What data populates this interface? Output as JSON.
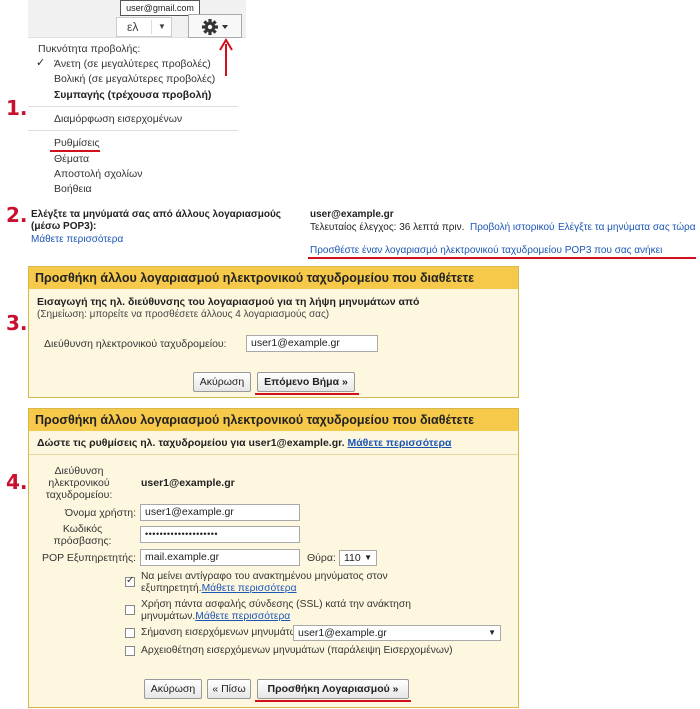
{
  "tooltip": {
    "email": "user@gmail.com"
  },
  "toolbar": {
    "lang_label": "ελ",
    "lang_caret": "▼"
  },
  "menu": {
    "density_header": "Πυκνότητα προβολής:",
    "items": [
      {
        "label": "Άνετη (σε μεγαλύτερες προβολές)",
        "checked": true
      },
      {
        "label": "Βολική (σε μεγαλύτερες προβολές)",
        "checked": false
      },
      {
        "label": "Συμπαγής (τρέχουσα προβολή)",
        "checked": false
      }
    ],
    "inbox_config": "Διαμόρφωση εισερχομένων",
    "settings": "Ρυθμίσεις",
    "themes": "Θέματα",
    "feedback": "Αποστολή σχολίων",
    "help": "Βοήθεια",
    "check_mark": "✓"
  },
  "steps": [
    "1.",
    "2.",
    "3.",
    "4."
  ],
  "step2": {
    "title_line1": "Ελέγξτε τα μηνύματά σας από άλλους λογαριασμούς",
    "title_line2": "(μέσω POP3):",
    "learn_more": "Μάθετε περισσότερα",
    "account": "user@example.gr",
    "last_check": "Τελευταίος έλεγχος: 36 λεπτά πριν.",
    "view_history": "Προβολή ιστορικού",
    "check_now": "Ελέγξτε τα μηνύματα σας τώρα",
    "add_account": "Προσθέστε έναν λογαριασμό ηλεκτρονικού ταχυδρομείου POP3 που σας ανήκει"
  },
  "step3": {
    "title": "Προσθήκη άλλου λογαριασμού ηλεκτρονικού ταχυδρομείου που διαθέτετε",
    "heading": "Εισαγωγή της ηλ. διεύθυνσης του λογαριασμού για τη λήψη μηνυμάτων από",
    "note": "(Σημείωση: μπορείτε να προσθέσετε άλλους 4 λογαριασμούς σας)",
    "email_label": "Διεύθυνση ηλεκτρονικού ταχυδρομείου:",
    "email_value": "user1@example.gr",
    "cancel": "Ακύρωση",
    "next": "Επόμενο Βήμα »"
  },
  "step4": {
    "title": "Προσθήκη άλλου λογαριασμού ηλεκτρονικού ταχυδρομείου που διαθέτετε",
    "heading_prefix": "Δώστε τις ρυθμίσεις ηλ. ταχυδρομείου για user1@example.gr.",
    "learn_more": "Μάθετε περισσότερα",
    "address_label_1": "Διεύθυνση",
    "address_label_2": "ηλεκτρονικού",
    "address_label_3": "ταχυδρομείου:",
    "address_value": "user1@example.gr",
    "username_label": "Όνομα χρήστη:",
    "username_value": "user1@example.gr",
    "password_label_1": "Κωδικός",
    "password_label_2": "πρόσβασης:",
    "password_value": "••••••••••••••••••••",
    "pop_label": "POP Εξυπηρετητής:",
    "pop_value": "mail.example.gr",
    "port_label": "Θύρα:",
    "port_value": "110",
    "options": [
      {
        "line1": "Να μείνει αντίγραφο του ανακτημένου μηνύματος στον",
        "line2": "εξυπηρετητή.",
        "link": "Μάθετε περισσότερα",
        "checked": true
      },
      {
        "line1": "Χρήση πάντα ασφαλής σύνδεσης (SSL) κατά την ανάκτηση",
        "line2": "μηνυμάτων.",
        "link": "Μάθετε περισσότερα",
        "checked": false
      },
      {
        "line1": "Σήμανση εισερχόμενων μηνυμάτων",
        "checked": false,
        "select": "user1@example.gr"
      },
      {
        "line1": "Αρχειοθέτηση εισερχόμενων μηνυμάτων (παράλειψη Εισερχομένων)",
        "checked": false
      }
    ],
    "cancel": "Ακύρωση",
    "back": "« Πίσω",
    "add": "Προσθήκη Λογαριασμού »"
  },
  "colors": {
    "accent_red": "#d0101c",
    "panel_header": "#f6c94b",
    "panel_bg": "#fdf7e0",
    "link": "#1a55b5"
  }
}
